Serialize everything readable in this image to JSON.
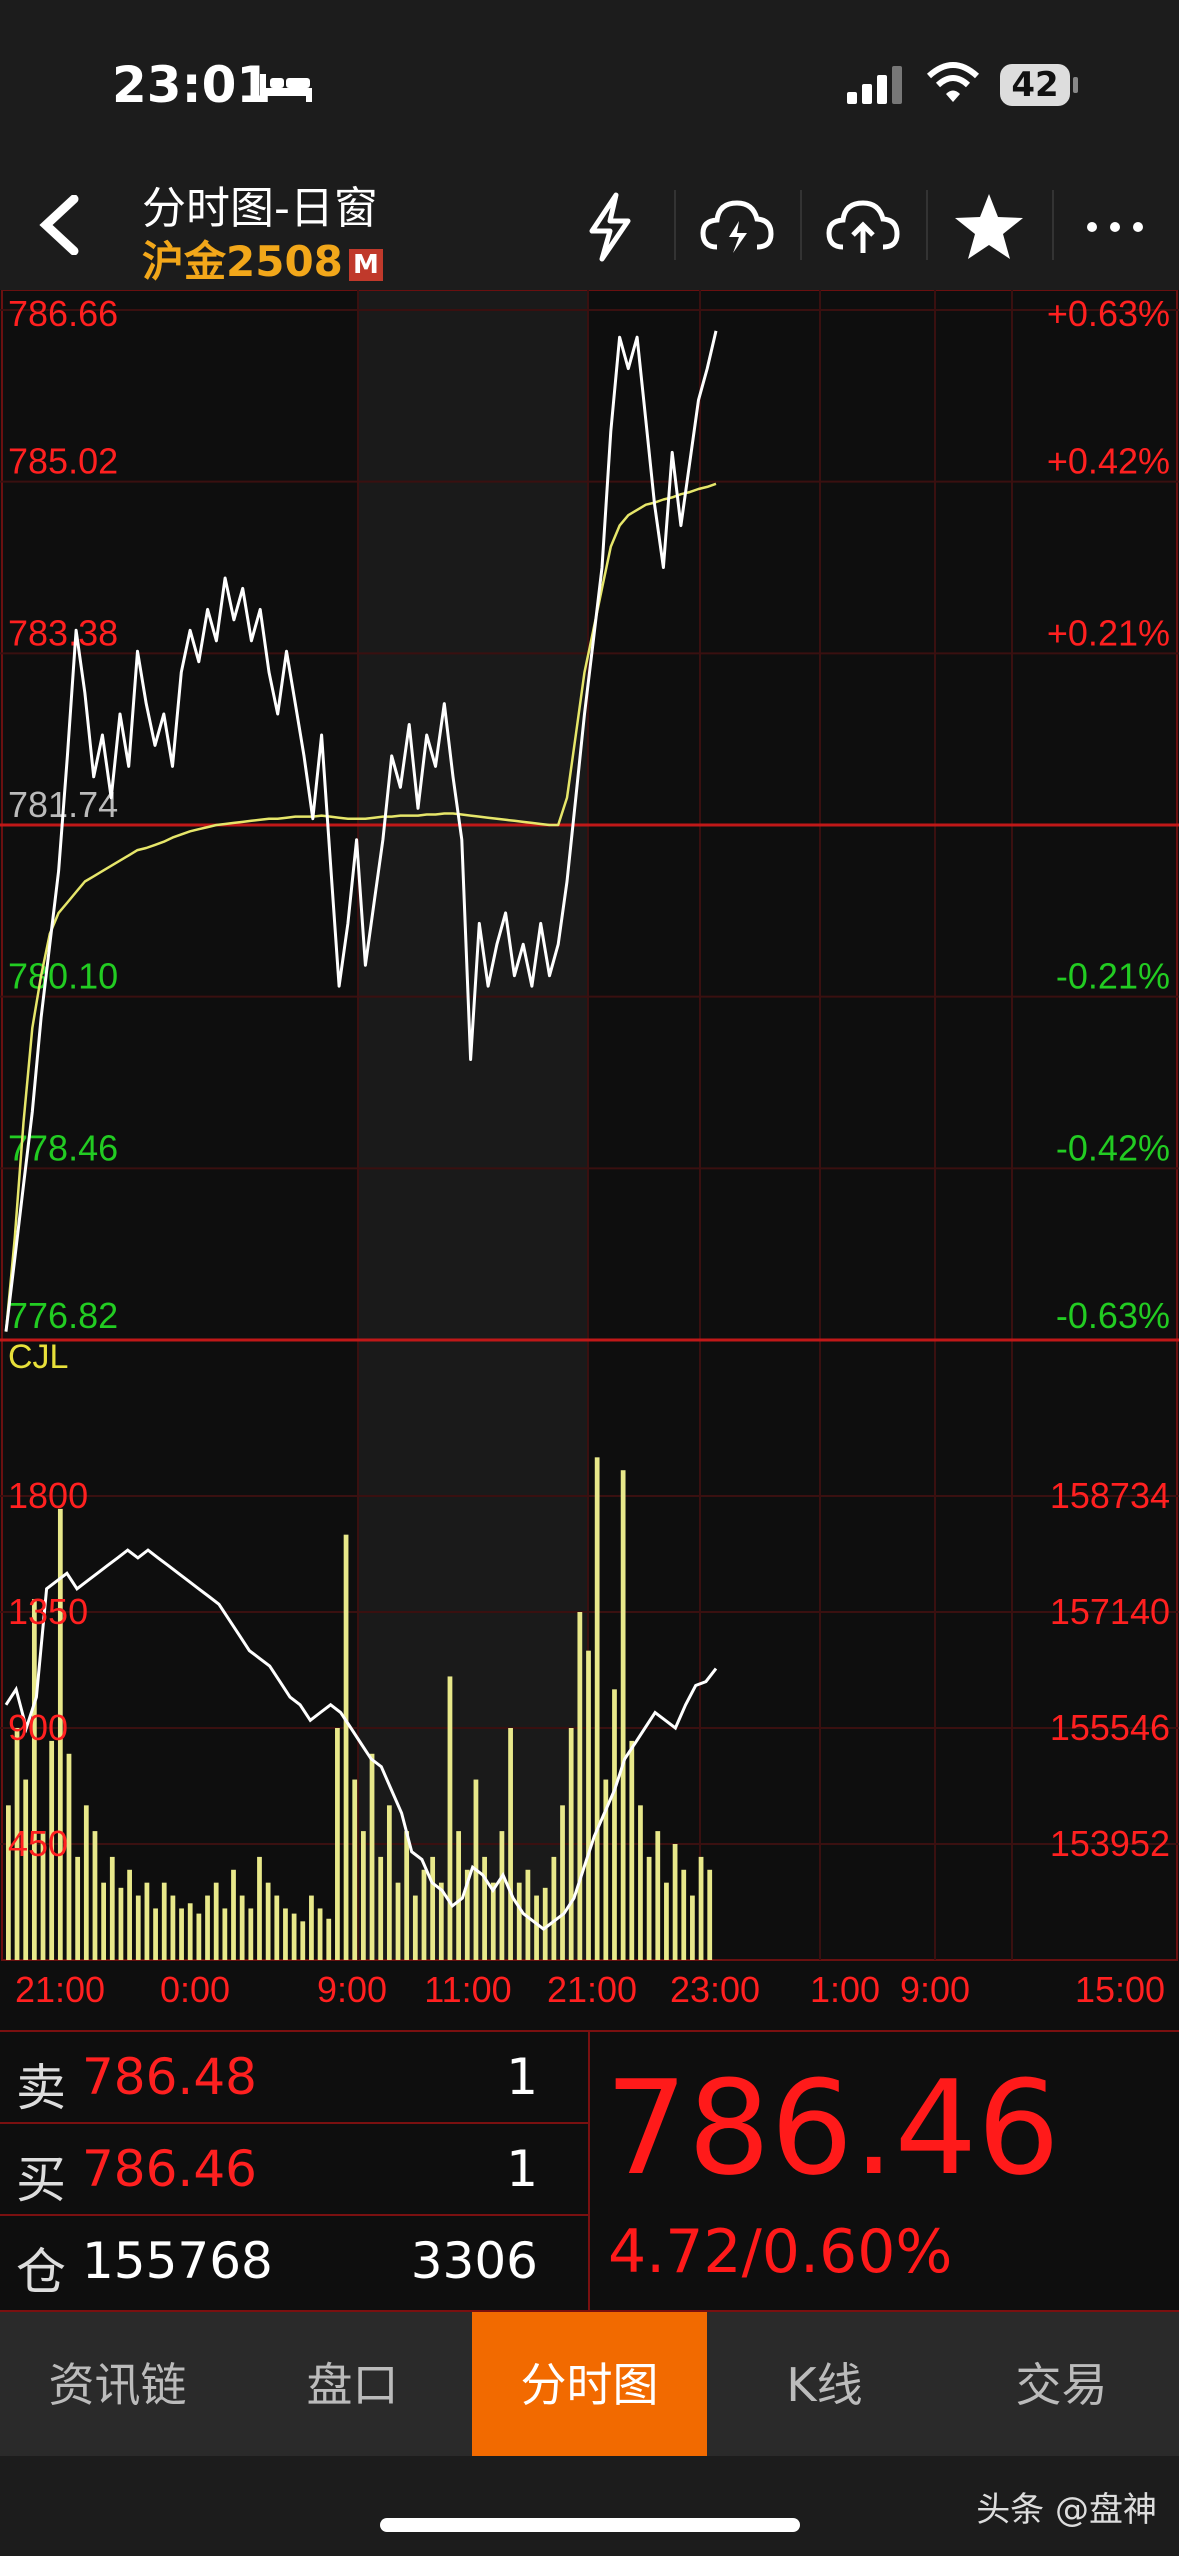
{
  "status": {
    "time": "23:01",
    "battery": "42"
  },
  "header": {
    "title": "分时图-日窗",
    "symbol": "沪金2508",
    "badge": "M"
  },
  "price_axis": {
    "left": [
      "786.66",
      "785.02",
      "783.38",
      "781.74",
      "780.10",
      "778.46",
      "776.82"
    ],
    "right": [
      "+0.63%",
      "+0.42%",
      "+0.21%",
      "",
      "-0.21%",
      "-0.42%",
      "-0.63%"
    ]
  },
  "volume_axis": {
    "label": "CJL",
    "left": [
      "1800",
      "1350",
      "900",
      "450"
    ],
    "right": [
      "158734",
      "157140",
      "155546",
      "153952"
    ]
  },
  "time_axis": [
    "21:00",
    "0:00",
    "9:00",
    "11:00",
    "21:00",
    "23:00",
    "1:00",
    "9:00",
    "15:00"
  ],
  "quote": {
    "sell_label": "卖",
    "sell_price": "786.48",
    "sell_qty": "1",
    "buy_label": "买",
    "buy_price": "786.46",
    "buy_qty": "1",
    "oi_label": "仓",
    "oi_value": "155768",
    "oi_change": "3306",
    "last_price": "786.46",
    "change": "4.72/0.60%"
  },
  "tabs": [
    "资讯链",
    "盘口",
    "分时图",
    "K线",
    "交易"
  ],
  "active_tab": "分时图",
  "watermark": "头条 @盘神",
  "colors": {
    "up": "#ff2020",
    "down": "#22cc22",
    "avg_line": "#e6e66a",
    "volume": "#e8e88a",
    "active_tab": "#f26a00"
  },
  "chart_data": {
    "type": "line",
    "prev_close": 781.74,
    "ylim": [
      776.82,
      786.66
    ],
    "price_series": [
      776.9,
      777.6,
      778.3,
      779.0,
      779.9,
      780.6,
      781.3,
      782.4,
      783.6,
      783.0,
      782.2,
      782.6,
      782.0,
      782.8,
      782.3,
      783.4,
      782.9,
      782.5,
      782.8,
      782.3,
      783.2,
      783.6,
      783.3,
      783.8,
      783.5,
      784.1,
      783.7,
      784.0,
      783.5,
      783.8,
      783.2,
      782.8,
      783.4,
      782.9,
      782.4,
      781.8,
      782.6,
      781.4,
      780.2,
      780.8,
      781.6,
      780.4,
      781.0,
      781.6,
      782.4,
      782.1,
      782.7,
      781.9,
      782.6,
      782.3,
      782.9,
      782.2,
      781.6,
      779.5,
      780.8,
      780.2,
      780.6,
      780.9,
      780.3,
      780.6,
      780.2,
      780.8,
      780.3,
      780.6,
      781.2,
      782.0,
      782.8,
      783.5,
      784.2,
      785.5,
      786.4,
      786.1,
      786.4,
      785.6,
      784.8,
      784.2,
      785.3,
      784.6,
      785.2,
      785.8,
      786.1,
      786.46
    ],
    "avg_series": [
      776.9,
      777.8,
      778.9,
      779.8,
      780.3,
      780.7,
      780.9,
      781.0,
      781.1,
      781.2,
      781.25,
      781.3,
      781.35,
      781.4,
      781.45,
      781.5,
      781.52,
      781.55,
      781.58,
      781.62,
      781.65,
      781.68,
      781.7,
      781.72,
      781.74,
      781.75,
      781.76,
      781.77,
      781.78,
      781.79,
      781.8,
      781.8,
      781.81,
      781.82,
      781.82,
      781.82,
      781.83,
      781.82,
      781.81,
      781.8,
      781.8,
      781.8,
      781.81,
      781.82,
      781.82,
      781.83,
      781.83,
      781.83,
      781.84,
      781.84,
      781.85,
      781.85,
      781.84,
      781.83,
      781.82,
      781.81,
      781.8,
      781.79,
      781.78,
      781.77,
      781.76,
      781.75,
      781.74,
      781.74,
      782.0,
      782.6,
      783.2,
      783.6,
      784.0,
      784.4,
      784.6,
      784.7,
      784.75,
      784.8,
      784.82,
      784.85,
      784.87,
      784.9,
      784.92,
      784.95,
      784.97,
      785.0
    ],
    "volume_series": [
      600,
      900,
      700,
      1400,
      500,
      850,
      1750,
      800,
      400,
      600,
      500,
      300,
      400,
      280,
      350,
      250,
      300,
      200,
      300,
      250,
      200,
      220,
      180,
      250,
      300,
      200,
      350,
      250,
      200,
      400,
      300,
      250,
      200,
      180,
      150,
      250,
      200,
      160,
      900,
      1650,
      700,
      500,
      800,
      400,
      600,
      300,
      500,
      250,
      350,
      400,
      300,
      1100,
      500,
      350,
      700,
      400,
      300,
      500,
      900,
      300,
      350,
      250,
      280,
      400,
      600,
      900,
      1350,
      1200,
      1950,
      700,
      1050,
      1900,
      850,
      600,
      400,
      500,
      300,
      450,
      350,
      250,
      400,
      350
    ],
    "oi_series": [
      155300,
      155500,
      155000,
      155400,
      156800,
      156900,
      157000,
      156800,
      156900,
      157000,
      157100,
      157200,
      157300,
      157200,
      157300,
      157200,
      157100,
      157000,
      156900,
      156800,
      156700,
      156600,
      156400,
      156200,
      156000,
      155900,
      155800,
      155600,
      155400,
      155300,
      155100,
      155200,
      155300,
      155200,
      155000,
      154800,
      154600,
      154500,
      154200,
      153900,
      153400,
      153300,
      153000,
      152900,
      152700,
      152800,
      153200,
      153100,
      152900,
      153100,
      152800,
      152600,
      152500,
      152400,
      152500,
      152600,
      152800,
      153200,
      153600,
      153900,
      154200,
      154600,
      154800,
      155000,
      155200,
      155100,
      155000,
      155300,
      155550,
      155600,
      155768
    ]
  }
}
